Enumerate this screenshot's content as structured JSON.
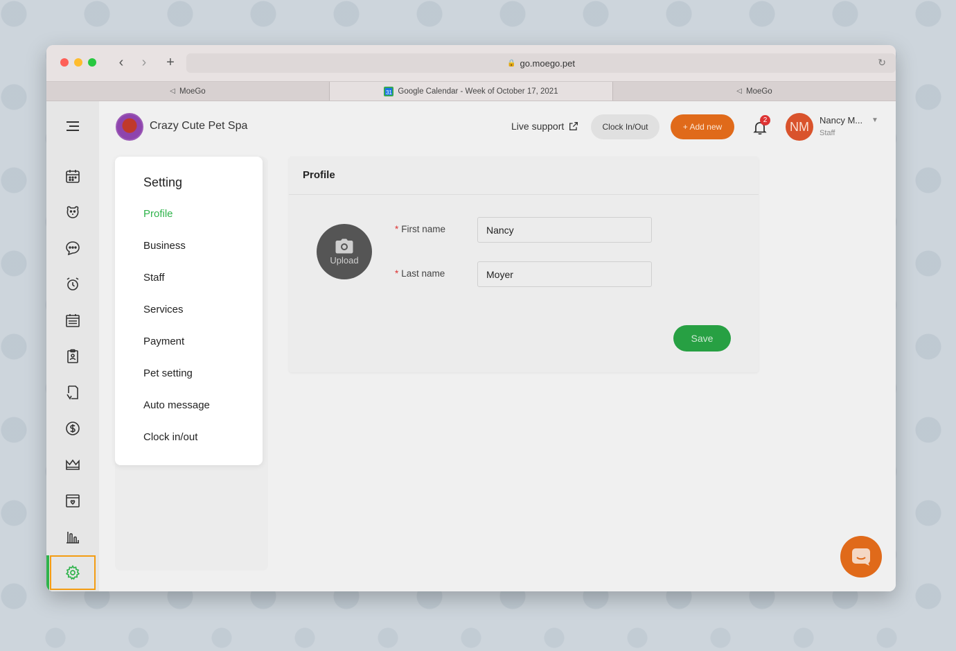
{
  "browser": {
    "url": "go.moego.pet",
    "tabs": [
      {
        "label": "MoeGo",
        "icon": "moego-icon"
      },
      {
        "label": "Google Calendar - Week of October 17, 2021",
        "icon": "google-calendar-icon",
        "icon_text": "31"
      },
      {
        "label": "MoeGo",
        "icon": "moego-icon"
      }
    ],
    "active_tab": 1
  },
  "header": {
    "business_name": "Crazy Cute Pet Spa",
    "live_support": "Live support",
    "clock_button": "Clock In/Out",
    "add_new_button": "+ Add new",
    "notification_count": "2",
    "user_initials": "NM",
    "user_name": "Nancy M...",
    "user_role": "Staff"
  },
  "rail": {
    "items": [
      "menu-icon",
      "calendar-icon",
      "pet-icon",
      "chat-icon",
      "alarm-icon",
      "schedule-icon",
      "clipboard-icon",
      "document-icon",
      "dollar-icon",
      "crown-icon",
      "booking-icon",
      "chart-icon",
      "gear-icon"
    ],
    "active": "gear-icon"
  },
  "settings": {
    "title": "Setting",
    "items": [
      "Profile",
      "Business",
      "Staff",
      "Services",
      "Payment",
      "Pet setting",
      "Auto message",
      "Clock in/out"
    ],
    "active": "Profile"
  },
  "profile": {
    "title": "Profile",
    "upload_label": "Upload",
    "first_name_label": "First name",
    "first_name_value": "Nancy",
    "last_name_label": "Last name",
    "last_name_value": "Moyer",
    "required_mark": "*",
    "save_label": "Save"
  },
  "colors": {
    "accent_green": "#2fb34b",
    "brand_orange": "#e06a1a",
    "save_green": "#27a043"
  }
}
